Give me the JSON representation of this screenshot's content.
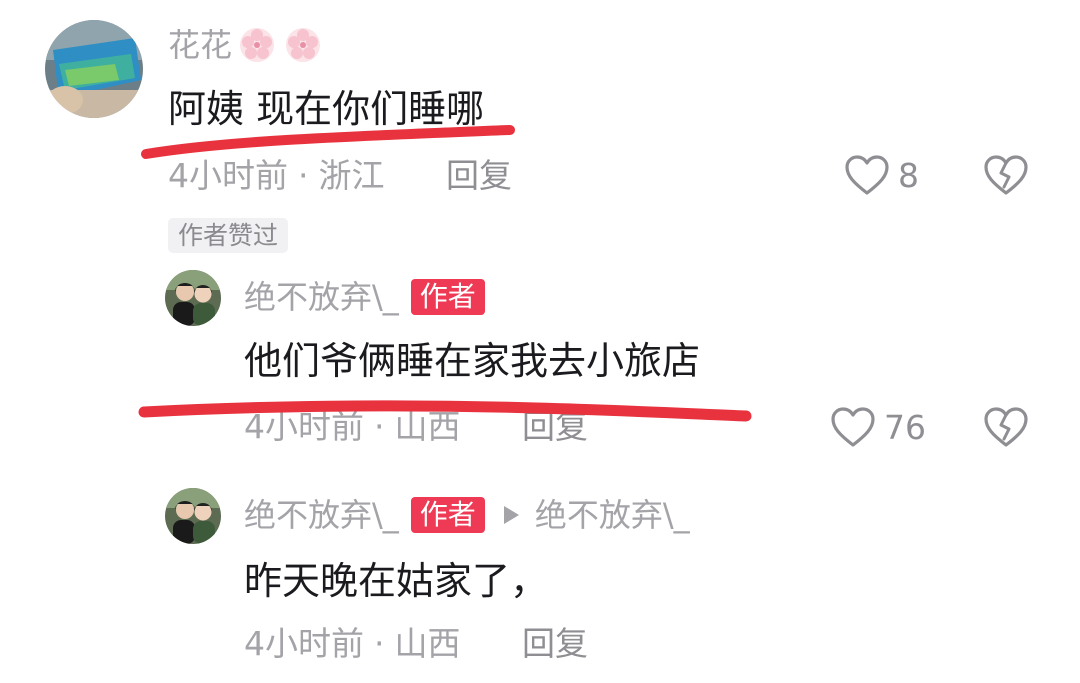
{
  "comments": [
    {
      "username": "花花",
      "text": "阿姨 现在你们睡哪",
      "time": "4小时前",
      "location": "浙江",
      "reply_label": "回复",
      "likes": "8",
      "liked_by_author_label": "作者赞过"
    },
    {
      "username": "绝不放弃\\_",
      "author_badge": "作者",
      "text": "他们爷俩睡在家我去小旅店",
      "time": "4小时前",
      "location": "山西",
      "reply_label": "回复",
      "likes": "76"
    },
    {
      "username": "绝不放弃\\_",
      "author_badge": "作者",
      "reply_to": "绝不放弃\\_",
      "text": "昨天晚在姑家了，",
      "time": "4小时前",
      "location": "山西",
      "reply_label": "回复"
    }
  ],
  "icons": {
    "username_emoji": "cherry-blossom-icon",
    "like": "heart-icon",
    "dislike": "broken-heart-icon",
    "reply_arrow": "play-arrow-icon"
  },
  "colors": {
    "author_badge": "#ee3a55",
    "highlight_stroke": "#e8333f",
    "username": "#a3a3a8",
    "text": "#1b1b1f"
  }
}
